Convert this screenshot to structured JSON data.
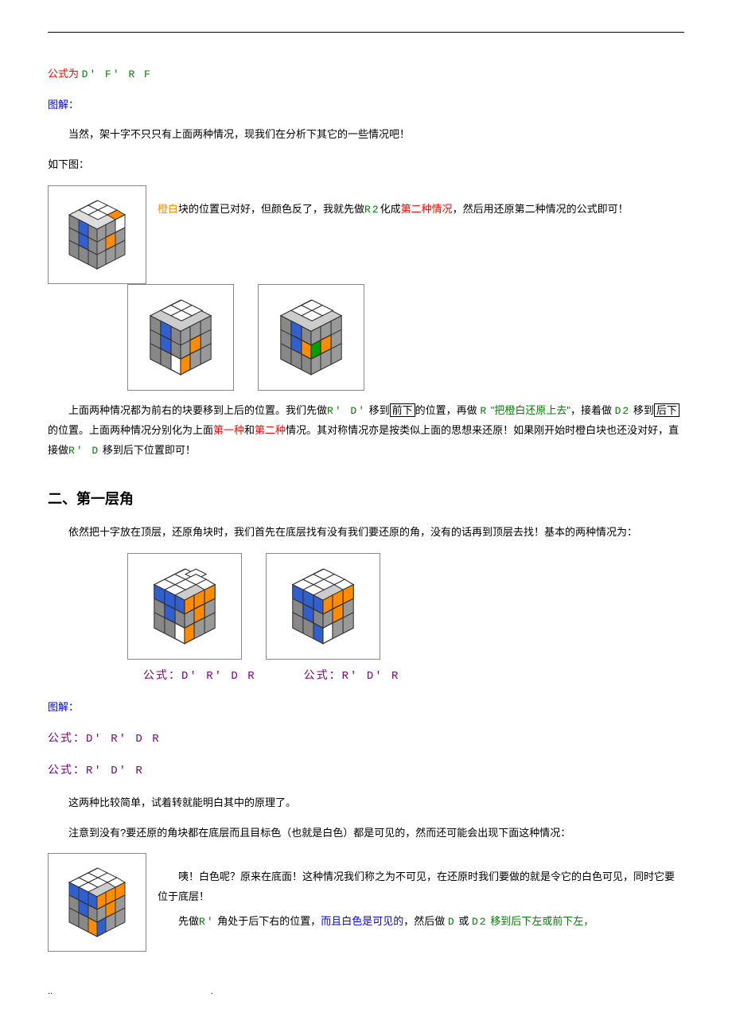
{
  "top_formula_prefix": "公式为",
  "top_formula": "D'  F'  R  F",
  "diagram_label": "图解：",
  "para1": "当然，架十字不只只有上面两种情况，现我们在分析下其它的一些情况吧！",
  "para1b": "如下图：",
  "side1_a": "橙白",
  "side1_b": "块的位置已对好，但颜色反了，我就先做",
  "side1_c": "R2",
  "side1_d": "化成",
  "side1_e": "第二种情况",
  "side1_f": "，然后用还原第二种情况的公式即可！",
  "para2_a": "上面两种情况都为前右的块要移到上后的位置。我们先做",
  "para2_b": "R'  D'",
  "para2_c": "  移到",
  "para2_box1": "前下",
  "para2_d": "的位置，再做",
  "para2_e": "R",
  "para2_f": "\"把橙白还原上去\"",
  "para2_g": "，接着做",
  "para2_h": "D2",
  "para2_i": "移到",
  "para2_box2": "后下",
  "para2_j": "的位置。上面两种情况分别化为上面",
  "para2_k": "第一种",
  "para2_l": "和",
  "para2_m": "第二种",
  "para2_n": "情况。其对称情况亦是按类似上面的思想来还原！如果刚开始时橙白块也还没对好，直接做",
  "para2_o": "R'  D",
  "para2_p": "移到后下位置即可！",
  "section2_title": "二、第一层角",
  "para3": "依然把十字放在顶层，还原角块时，我们首先在底层找有没有我们要还原的角，没有的话再到顶层去找！基本的两种情况为：",
  "formula_label": "公式：",
  "formula1": "D' R' D R",
  "formula2": "R' D' R",
  "diagram_label2": "图解：",
  "formula_line1_prefix": "公式：",
  "formula_line1": "D' R' D R",
  "formula_line2_prefix": "公式：",
  "formula_line2": "R' D' R",
  "para4": "这两种比较简单，试着转就能明白其中的原理了。",
  "para5": "注意到没有?要还原的角块都在底层而且目标色（也就是白色）都是可见的，然而还可能会出现下面这种情况：",
  "side2_a": "咦！白色呢？原来在底面！这种情况我们称之为不可见，在还原时我们要做的就是令它的白色可见，同时它要位于底层！",
  "side2_b": "先做",
  "side2_c": "R'",
  "side2_d": "  角处于后下右的位置，",
  "side2_e": "而且白色是可见的",
  "side2_f": "，然后做",
  "side2_g": "D",
  "side2_h": "或",
  "side2_i": "D2",
  "side2_j": "移到后下左或前下左，"
}
